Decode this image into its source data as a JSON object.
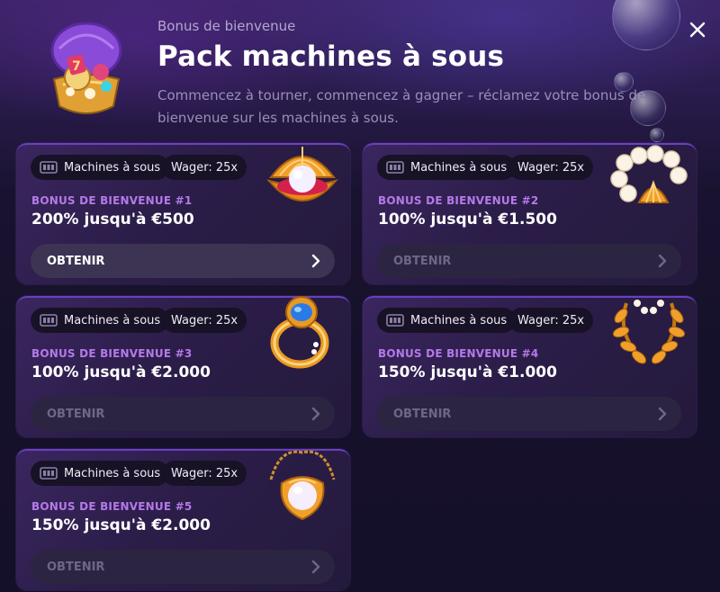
{
  "header": {
    "subtitle": "Bonus de bienvenue",
    "title": "Pack machines à sous",
    "description": "Commencez à tourner, commencez à gagner – réclamez votre bonus de bienvenue sur les machines à sous."
  },
  "icons": {
    "header": "treasure-chest-icon",
    "close": "close-icon",
    "category": "slot-machine-icon",
    "arrow": "chevron-right-icon"
  },
  "colors": {
    "label_purple": "#b47ae8",
    "card_border": "#6b3fc2",
    "background": "#17112a"
  },
  "cards": [
    {
      "category": "Machines à sous",
      "wager": "Wager: 25x",
      "label": "BONUS DE BIENVENUE #1",
      "amount": "200% jusqu'à €500",
      "button": "OBTENIR",
      "art": "pearl-shell-icon"
    },
    {
      "category": "Machines à sous",
      "wager": "Wager: 25x",
      "label": "BONUS DE BIENVENUE #2",
      "amount": "100% jusqu'à €1.500",
      "button": "OBTENIR",
      "art": "pearl-bracelet-icon"
    },
    {
      "category": "Machines à sous",
      "wager": "Wager: 25x",
      "label": "BONUS DE BIENVENUE #3",
      "amount": "100% jusqu'à €2.000",
      "button": "OBTENIR",
      "art": "sapphire-ring-icon"
    },
    {
      "category": "Machines à sous",
      "wager": "Wager: 25x",
      "label": "BONUS DE BIENVENUE #4",
      "amount": "150% jusqu'à €1.000",
      "button": "OBTENIR",
      "art": "laurel-wreath-icon"
    },
    {
      "category": "Machines à sous",
      "wager": "Wager: 25x",
      "label": "BONUS DE BIENVENUE #5",
      "amount": "150% jusqu'à €2.000",
      "button": "OBTENIR",
      "art": "pearl-pendant-icon"
    }
  ]
}
